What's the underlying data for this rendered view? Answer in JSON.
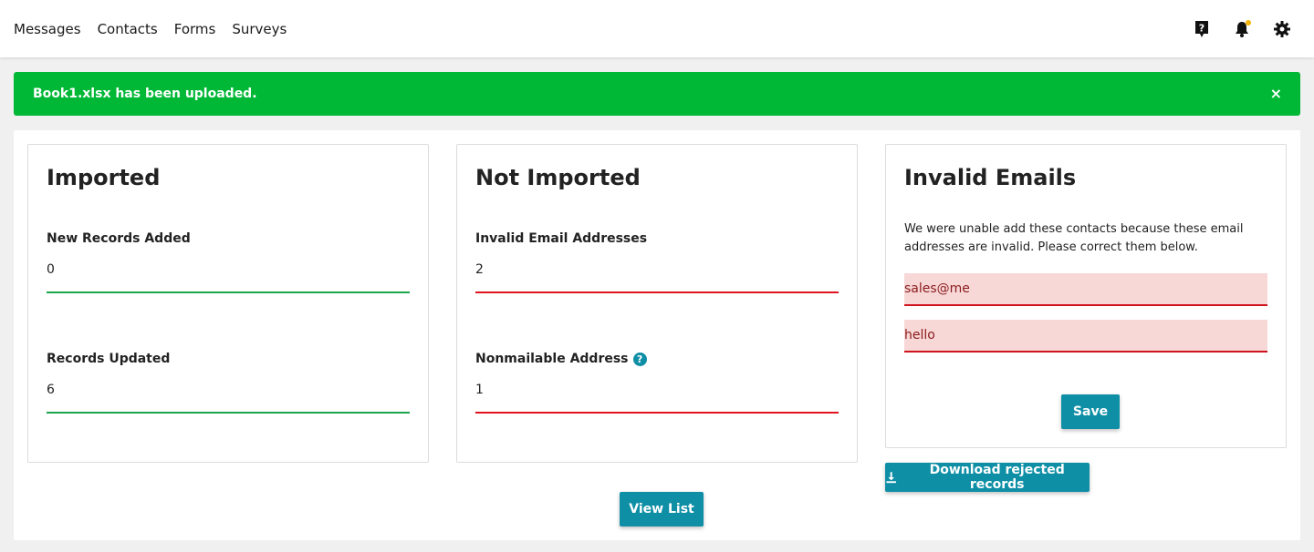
{
  "nav": {
    "links": [
      "Messages",
      "Contacts",
      "Forms",
      "Surveys"
    ],
    "icons": [
      "help-icon",
      "bell-icon",
      "gear-icon"
    ]
  },
  "alert": {
    "message": "Book1.xlsx has been uploaded.",
    "close": "×"
  },
  "imported": {
    "title": "Imported",
    "new_records_label": "New Records Added",
    "new_records_value": "0",
    "updated_label": "Records Updated",
    "updated_value": "6"
  },
  "not_imported": {
    "title": "Not Imported",
    "invalid_label": "Invalid Email Addresses",
    "invalid_value": "2",
    "nonmailable_label": "Nonmailable Address",
    "nonmailable_value": "1"
  },
  "invalid_emails": {
    "title": "Invalid Emails",
    "description": "We were unable add these contacts because these email addresses are invalid. Please correct them below.",
    "emails": [
      "sales@me",
      "hello"
    ],
    "save_label": "Save"
  },
  "buttons": {
    "view_list": "View List",
    "download_rejected": "Download rejected records"
  },
  "colors": {
    "accent": "#0f8fa6",
    "success": "#00b836",
    "error": "#e0141e"
  }
}
